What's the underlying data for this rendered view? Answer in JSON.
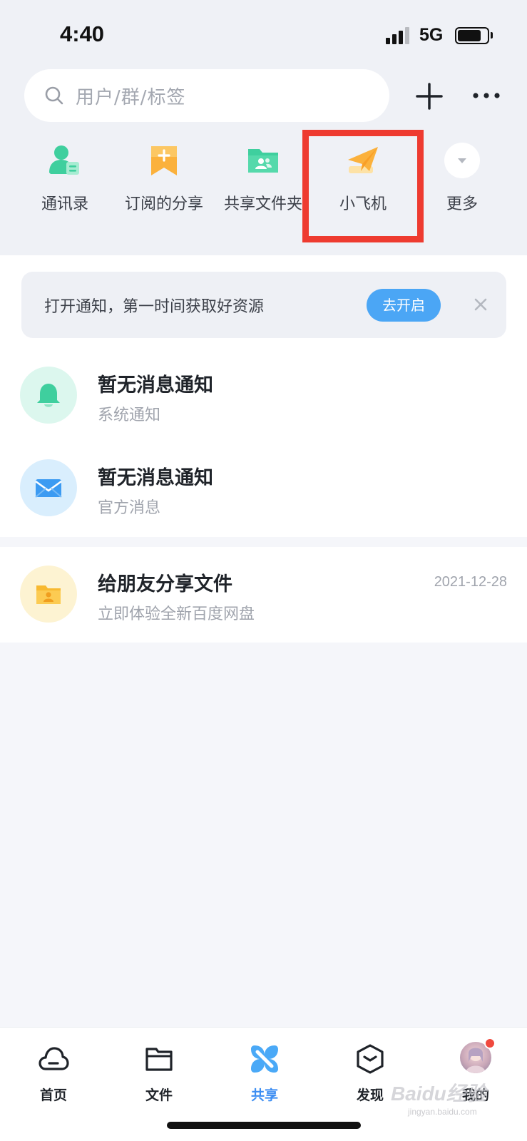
{
  "status_bar": {
    "time": "4:40",
    "network": "5G"
  },
  "search": {
    "placeholder": "用户/群/标签"
  },
  "shortcuts": [
    {
      "label": "通讯录",
      "icon": "contacts-icon"
    },
    {
      "label": "订阅的分享",
      "icon": "bookmark-plus-icon"
    },
    {
      "label": "共享文件夹",
      "icon": "shared-folder-icon"
    },
    {
      "label": "小飞机",
      "icon": "paper-plane-icon"
    },
    {
      "label": "更多",
      "icon": "chevron-down-icon"
    }
  ],
  "notice": {
    "text": "打开通知，第一时间获取好资源",
    "button": "去开启"
  },
  "messages": [
    {
      "title": "暂无消息通知",
      "subtitle": "系统通知",
      "icon": "bell-icon"
    },
    {
      "title": "暂无消息通知",
      "subtitle": "官方消息",
      "icon": "mail-icon"
    },
    {
      "title": "给朋友分享文件",
      "subtitle": "立即体验全新百度网盘",
      "date": "2021-12-28",
      "icon": "folder-user-icon"
    }
  ],
  "tabs": [
    {
      "label": "首页",
      "icon": "cloud-icon"
    },
    {
      "label": "文件",
      "icon": "folder-icon"
    },
    {
      "label": "共享",
      "icon": "share-icon",
      "active": true
    },
    {
      "label": "发现",
      "icon": "discover-icon"
    },
    {
      "label": "我的",
      "icon": "avatar"
    }
  ],
  "colors": {
    "accent": "#3d8ef2",
    "highlight": "#ee3b30",
    "notice_button": "#4ba6f5"
  },
  "watermark": {
    "main": "Baidu经验",
    "sub": "jingyan.baidu.com"
  }
}
